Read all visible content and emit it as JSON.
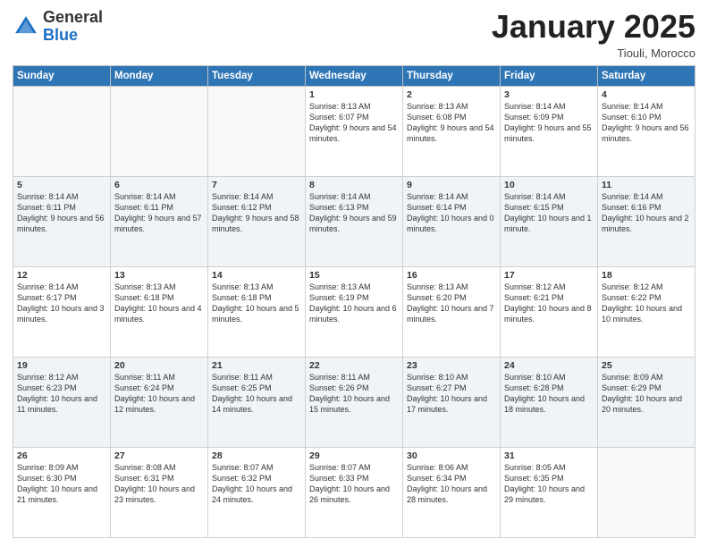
{
  "header": {
    "logo_general": "General",
    "logo_blue": "Blue",
    "month_year": "January 2025",
    "location": "Tiouli, Morocco"
  },
  "days_of_week": [
    "Sunday",
    "Monday",
    "Tuesday",
    "Wednesday",
    "Thursday",
    "Friday",
    "Saturday"
  ],
  "weeks": [
    [
      {
        "day": "",
        "info": ""
      },
      {
        "day": "",
        "info": ""
      },
      {
        "day": "",
        "info": ""
      },
      {
        "day": "1",
        "info": "Sunrise: 8:13 AM\nSunset: 6:07 PM\nDaylight: 9 hours\nand 54 minutes."
      },
      {
        "day": "2",
        "info": "Sunrise: 8:13 AM\nSunset: 6:08 PM\nDaylight: 9 hours\nand 54 minutes."
      },
      {
        "day": "3",
        "info": "Sunrise: 8:14 AM\nSunset: 6:09 PM\nDaylight: 9 hours\nand 55 minutes."
      },
      {
        "day": "4",
        "info": "Sunrise: 8:14 AM\nSunset: 6:10 PM\nDaylight: 9 hours\nand 56 minutes."
      }
    ],
    [
      {
        "day": "5",
        "info": "Sunrise: 8:14 AM\nSunset: 6:11 PM\nDaylight: 9 hours\nand 56 minutes."
      },
      {
        "day": "6",
        "info": "Sunrise: 8:14 AM\nSunset: 6:11 PM\nDaylight: 9 hours\nand 57 minutes."
      },
      {
        "day": "7",
        "info": "Sunrise: 8:14 AM\nSunset: 6:12 PM\nDaylight: 9 hours\nand 58 minutes."
      },
      {
        "day": "8",
        "info": "Sunrise: 8:14 AM\nSunset: 6:13 PM\nDaylight: 9 hours\nand 59 minutes."
      },
      {
        "day": "9",
        "info": "Sunrise: 8:14 AM\nSunset: 6:14 PM\nDaylight: 10 hours\nand 0 minutes."
      },
      {
        "day": "10",
        "info": "Sunrise: 8:14 AM\nSunset: 6:15 PM\nDaylight: 10 hours\nand 1 minute."
      },
      {
        "day": "11",
        "info": "Sunrise: 8:14 AM\nSunset: 6:16 PM\nDaylight: 10 hours\nand 2 minutes."
      }
    ],
    [
      {
        "day": "12",
        "info": "Sunrise: 8:14 AM\nSunset: 6:17 PM\nDaylight: 10 hours\nand 3 minutes."
      },
      {
        "day": "13",
        "info": "Sunrise: 8:13 AM\nSunset: 6:18 PM\nDaylight: 10 hours\nand 4 minutes."
      },
      {
        "day": "14",
        "info": "Sunrise: 8:13 AM\nSunset: 6:18 PM\nDaylight: 10 hours\nand 5 minutes."
      },
      {
        "day": "15",
        "info": "Sunrise: 8:13 AM\nSunset: 6:19 PM\nDaylight: 10 hours\nand 6 minutes."
      },
      {
        "day": "16",
        "info": "Sunrise: 8:13 AM\nSunset: 6:20 PM\nDaylight: 10 hours\nand 7 minutes."
      },
      {
        "day": "17",
        "info": "Sunrise: 8:12 AM\nSunset: 6:21 PM\nDaylight: 10 hours\nand 8 minutes."
      },
      {
        "day": "18",
        "info": "Sunrise: 8:12 AM\nSunset: 6:22 PM\nDaylight: 10 hours\nand 10 minutes."
      }
    ],
    [
      {
        "day": "19",
        "info": "Sunrise: 8:12 AM\nSunset: 6:23 PM\nDaylight: 10 hours\nand 11 minutes."
      },
      {
        "day": "20",
        "info": "Sunrise: 8:11 AM\nSunset: 6:24 PM\nDaylight: 10 hours\nand 12 minutes."
      },
      {
        "day": "21",
        "info": "Sunrise: 8:11 AM\nSunset: 6:25 PM\nDaylight: 10 hours\nand 14 minutes."
      },
      {
        "day": "22",
        "info": "Sunrise: 8:11 AM\nSunset: 6:26 PM\nDaylight: 10 hours\nand 15 minutes."
      },
      {
        "day": "23",
        "info": "Sunrise: 8:10 AM\nSunset: 6:27 PM\nDaylight: 10 hours\nand 17 minutes."
      },
      {
        "day": "24",
        "info": "Sunrise: 8:10 AM\nSunset: 6:28 PM\nDaylight: 10 hours\nand 18 minutes."
      },
      {
        "day": "25",
        "info": "Sunrise: 8:09 AM\nSunset: 6:29 PM\nDaylight: 10 hours\nand 20 minutes."
      }
    ],
    [
      {
        "day": "26",
        "info": "Sunrise: 8:09 AM\nSunset: 6:30 PM\nDaylight: 10 hours\nand 21 minutes."
      },
      {
        "day": "27",
        "info": "Sunrise: 8:08 AM\nSunset: 6:31 PM\nDaylight: 10 hours\nand 23 minutes."
      },
      {
        "day": "28",
        "info": "Sunrise: 8:07 AM\nSunset: 6:32 PM\nDaylight: 10 hours\nand 24 minutes."
      },
      {
        "day": "29",
        "info": "Sunrise: 8:07 AM\nSunset: 6:33 PM\nDaylight: 10 hours\nand 26 minutes."
      },
      {
        "day": "30",
        "info": "Sunrise: 8:06 AM\nSunset: 6:34 PM\nDaylight: 10 hours\nand 28 minutes."
      },
      {
        "day": "31",
        "info": "Sunrise: 8:05 AM\nSunset: 6:35 PM\nDaylight: 10 hours\nand 29 minutes."
      },
      {
        "day": "",
        "info": ""
      }
    ]
  ]
}
